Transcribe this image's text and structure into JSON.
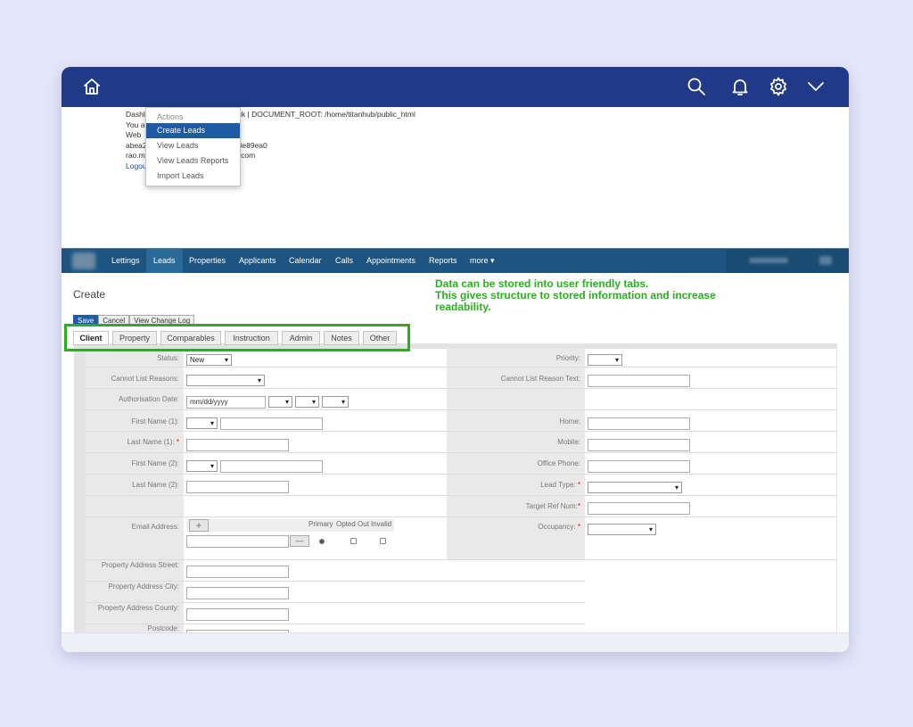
{
  "topbar": {
    "icons": [
      "home-icon",
      "search-icon",
      "bell-icon",
      "gear-icon",
      "chevron-down-icon"
    ],
    "color": "#213a87"
  },
  "debug": {
    "line1_prefix": "Dashl",
    "line1_suffix": "o.co.uk | DOCUMENT_ROOT: /home/titanhub/public_html",
    "line2": "You a",
    "line3": "Web",
    "line4_prefix": "abea2",
    "line4_suffix": "3e89ea0",
    "line5_prefix": "rao.m",
    "line5_suffix": ".com",
    "logout": "Logou"
  },
  "actions_menu": {
    "heading": "Actions",
    "items": [
      "Create Leads",
      "View Leads",
      "View Leads Reports",
      "Import Leads"
    ],
    "active_index": 0
  },
  "nav": {
    "items": [
      "Lettings",
      "Leads",
      "Properties",
      "Applicants",
      "Calendar",
      "Calls",
      "Appointments",
      "Reports",
      "more ▾"
    ],
    "active": "Leads"
  },
  "page": {
    "title": "Create",
    "annotation": [
      "Data can be stored into user friendly tabs.",
      "This gives structure to stored information and increase",
      "readability."
    ]
  },
  "action_buttons": [
    "Save",
    "Cancel",
    "View Change Log"
  ],
  "tabs": [
    "Client",
    "Property",
    "Comparables",
    "Instruction",
    "Admin",
    "Notes",
    "Other"
  ],
  "active_tab": "Client",
  "form": {
    "status_label": "Status:",
    "status_value": "New",
    "priority_label": "Priority:",
    "cannot_list_label": "Cannot List Reasons:",
    "cannot_list_text_label": "Cannot List Reason Text:",
    "auth_date_label": "Authorisation Date:",
    "auth_date_placeholder": "mm/dd/yyyy",
    "first_name1_label": "First Name (1):",
    "home_label": "Home:",
    "last_name1_label": "Last Name (1):",
    "mobile_label": "Mobile:",
    "first_name2_label": "First Name (2):",
    "office_phone_label": "Office Phone:",
    "last_name2_label": "Last Name (2):",
    "lead_type_label": "Lead Type:",
    "target_ref_label": "Target Ref Num:",
    "email_label": "Email Address:",
    "email_cols": [
      "Primary",
      "Opted Out",
      "Invalid"
    ],
    "occupancy_label": "Occupancy:",
    "street_label": "Property Address Street:",
    "city_label": "Property Address City:",
    "county_label": "Property Address County:",
    "postcode_label": "Postcode:"
  },
  "colors": {
    "background": "#e4e6fb",
    "annotation_green": "#28b11c",
    "navbar": "#1d5580",
    "save_button": "#1f5aa5"
  }
}
